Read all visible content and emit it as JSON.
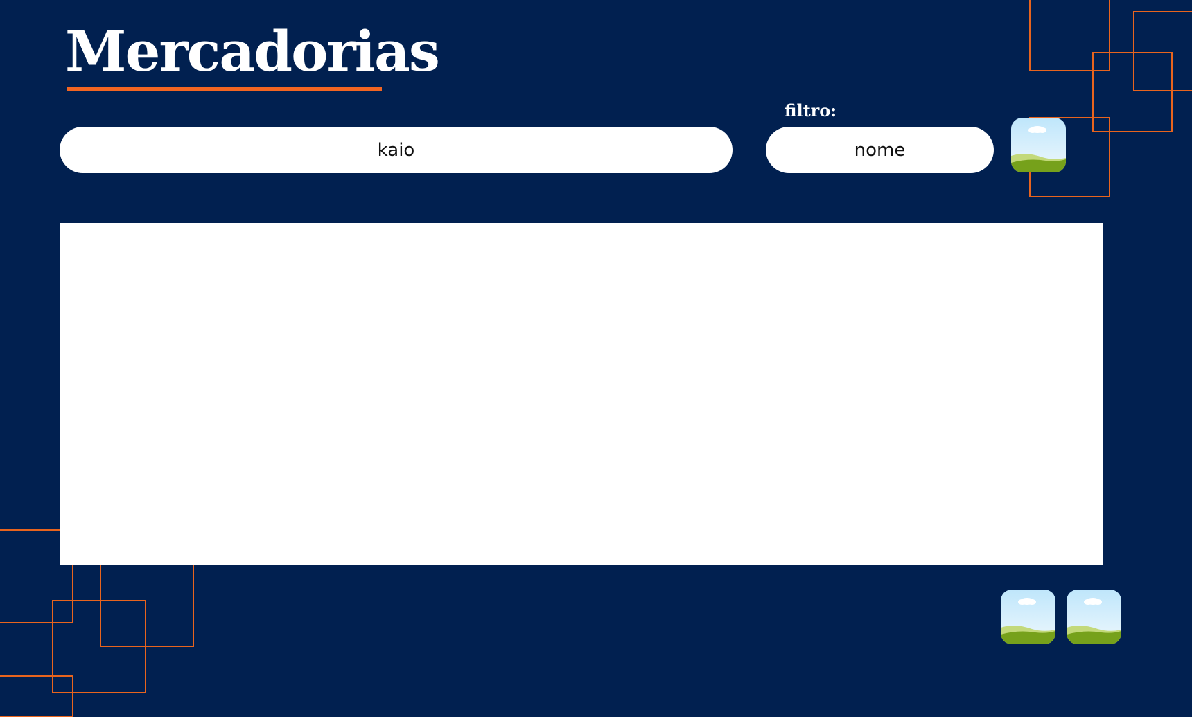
{
  "page": {
    "title": "Mercadorias",
    "background_color": "#012050",
    "accent_color": "#f26522",
    "decoration_color": "#e8641e"
  },
  "search": {
    "value": "kaio"
  },
  "filter": {
    "label": "filtro:",
    "value": "nome"
  },
  "image_buttons": {
    "icon": "landscape-image-icon"
  }
}
